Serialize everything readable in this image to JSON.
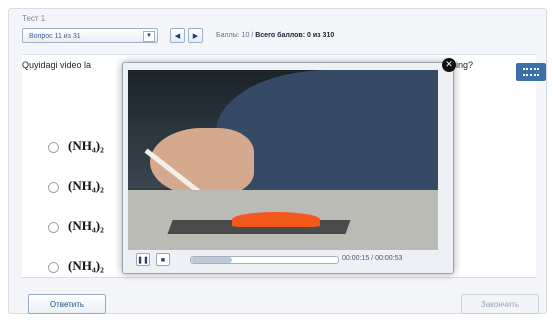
{
  "app": {
    "test_title": "Тест 1"
  },
  "toolbar": {
    "question_select": "Вопрос 11 из 31",
    "prev_icon": "◀",
    "next_icon": "▶",
    "score_label": "Баллы: 10",
    "score_sep": "/",
    "score_total": "Всего баллов: 0 из 310"
  },
  "question": {
    "text_start": "Quyidagi video la",
    "text_end": "ing?"
  },
  "options": [
    {
      "formula": "(NH₄)₂"
    },
    {
      "formula": "(NH₄)₂"
    },
    {
      "formula": "(NH₄)₂"
    },
    {
      "formula": "(NH₄)₂"
    }
  ],
  "video": {
    "time_current": "00:00:15",
    "time_separator": "/",
    "time_total": "00:00:53",
    "progress": 0.28,
    "close_icon": "✕",
    "pause_icon": "❚❚",
    "stop_icon": "■"
  },
  "footer": {
    "answer_button": "Ответить",
    "finish_button": "Закончить"
  },
  "icons": {
    "dropdown": "chevron-down-icon",
    "film": "film-icon"
  },
  "colors": {
    "accent": "#3c6ea8",
    "button_text": "#1d4d84"
  }
}
